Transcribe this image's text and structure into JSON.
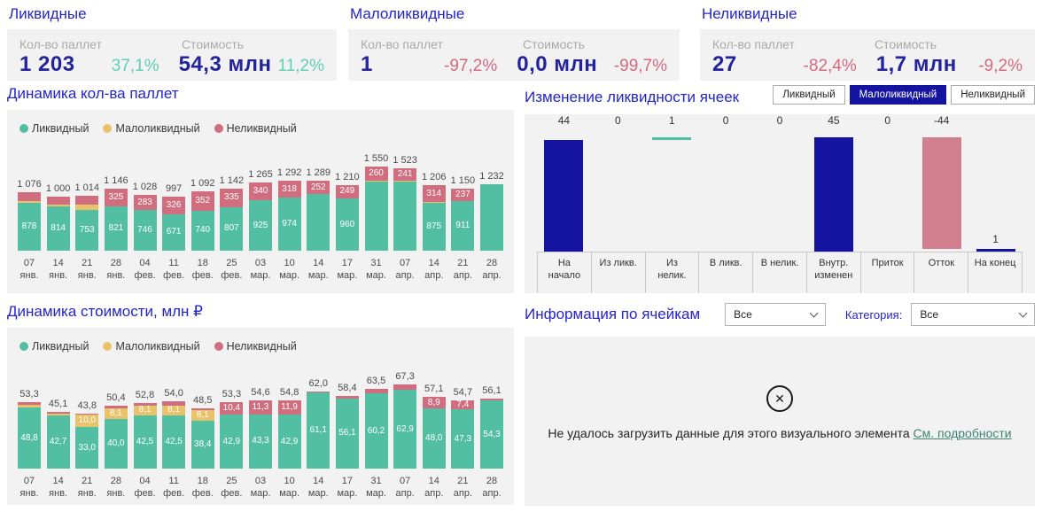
{
  "colors": {
    "title_blue": "#2424CB",
    "kpi_value_navy": "#23239B",
    "positive": "#5ED1B0",
    "negative": "#D5697F",
    "liquid_teal": "#53BFA2",
    "lowliquid_yellow": "#E9C36A",
    "illiquid_pink": "#D06E7F",
    "waterfall_navy": "#1414A0",
    "panel_bg": "#F2F2F2"
  },
  "kpi": {
    "cards": [
      {
        "title": "Ликвидные",
        "label1": "Кол-во паллет",
        "value1": "1 203",
        "pct1": "37,1%",
        "pct1_sign": "pos",
        "label2": "Стоимость",
        "value2": "54,3 млн",
        "pct2": "11,2%",
        "pct2_sign": "pos"
      },
      {
        "title": "Малоликвидные",
        "label1": "Кол-во паллет",
        "value1": "1",
        "pct1": "-97,2%",
        "pct1_sign": "neg",
        "label2": "Стоимость",
        "value2": "0,0 млн",
        "pct2": "-99,7%",
        "pct2_sign": "neg"
      },
      {
        "title": "Неликвидные",
        "label1": "Кол-во паллет",
        "value1": "27",
        "pct1": "-82,4%",
        "pct1_sign": "neg",
        "label2": "Стоимость",
        "value2": "1,7 млн",
        "pct2": "-9,2%",
        "pct2_sign": "neg"
      }
    ]
  },
  "chart_data": [
    {
      "id": "pallets",
      "type": "bar",
      "stacked": true,
      "title": "Динамика кол-ва паллет",
      "legend": [
        "Ликвидный",
        "Малоликвидный",
        "Неликвидный"
      ],
      "ylim": [
        0,
        1550
      ],
      "bars": [
        {
          "d": "07",
          "m": "янв.",
          "total": "1 076",
          "liq": 878,
          "mal": 38,
          "nel": 160,
          "liq_label": "878",
          "mal_label": "",
          "nel_label": ""
        },
        {
          "d": "14",
          "m": "янв.",
          "total": "1 000",
          "liq": 814,
          "mal": 30,
          "nel": 156,
          "liq_label": "814",
          "mal_label": "",
          "nel_label": ""
        },
        {
          "d": "21",
          "m": "янв.",
          "total": "1 014",
          "liq": 753,
          "mal": 90,
          "nel": 171,
          "liq_label": "753",
          "mal_label": "",
          "nel_label": ""
        },
        {
          "d": "28",
          "m": "янв.",
          "total": "1 146",
          "liq": 821,
          "mal": 0,
          "nel": 325,
          "liq_label": "821",
          "mal_label": "",
          "nel_label": "325"
        },
        {
          "d": "04",
          "m": "фев.",
          "total": "1 028",
          "liq": 746,
          "mal": 0,
          "nel": 283,
          "liq_label": "746",
          "mal_label": "",
          "nel_label": "283"
        },
        {
          "d": "11",
          "m": "фев.",
          "total": "997",
          "liq": 671,
          "mal": 0,
          "nel": 326,
          "liq_label": "671",
          "mal_label": "",
          "nel_label": "326"
        },
        {
          "d": "18",
          "m": "фев.",
          "total": "1 092",
          "liq": 740,
          "mal": 0,
          "nel": 352,
          "liq_label": "740",
          "mal_label": "",
          "nel_label": "352"
        },
        {
          "d": "25",
          "m": "фев.",
          "total": "1 142",
          "liq": 807,
          "mal": 0,
          "nel": 335,
          "liq_label": "807",
          "mal_label": "",
          "nel_label": "335"
        },
        {
          "d": "03",
          "m": "мар.",
          "total": "1 265",
          "liq": 925,
          "mal": 0,
          "nel": 340,
          "liq_label": "925",
          "mal_label": "",
          "nel_label": "340"
        },
        {
          "d": "10",
          "m": "мар.",
          "total": "1 292",
          "liq": 974,
          "mal": 0,
          "nel": 318,
          "liq_label": "974",
          "mal_label": "",
          "nel_label": "318"
        },
        {
          "d": "14",
          "m": "мар.",
          "total": "1 289",
          "liq": 1037,
          "mal": 0,
          "nel": 252,
          "liq_label": "",
          "mal_label": "",
          "nel_label": "252"
        },
        {
          "d": "17",
          "m": "мар.",
          "total": "1 210",
          "liq": 960,
          "mal": 1,
          "nel": 249,
          "liq_label": "960",
          "mal_label": "",
          "nel_label": "249"
        },
        {
          "d": "31",
          "m": "мар.",
          "total": "1 550",
          "liq": 1280,
          "mal": 10,
          "nel": 260,
          "liq_label": "",
          "mal_label": "",
          "nel_label": "260"
        },
        {
          "d": "07",
          "m": "апр.",
          "total": "1 523",
          "liq": 1272,
          "mal": 10,
          "nel": 241,
          "liq_label": "",
          "mal_label": "",
          "nel_label": "241"
        },
        {
          "d": "14",
          "m": "апр.",
          "total": "1 206",
          "liq": 875,
          "mal": 17,
          "nel": 314,
          "liq_label": "875",
          "mal_label": "",
          "nel_label": "314"
        },
        {
          "d": "21",
          "m": "апр.",
          "total": "1 150",
          "liq": 911,
          "mal": 2,
          "nel": 237,
          "liq_label": "911",
          "mal_label": "",
          "nel_label": "237"
        },
        {
          "d": "28",
          "m": "апр.",
          "total": "1 232",
          "liq": 1222,
          "mal": 0,
          "nel": 10,
          "liq_label": "",
          "mal_label": "",
          "nel_label": ""
        }
      ]
    },
    {
      "id": "liquidity_change",
      "type": "waterfall",
      "title": "Изменение ликвидности ячеек",
      "buttons": [
        "Ликвидный",
        "Малоликвидный",
        "Неликвидный"
      ],
      "selected_button": "Малоликвидный",
      "ylim": [
        0,
        45
      ],
      "steps": [
        {
          "label": "На\nначало",
          "value": "44",
          "from": 0,
          "to": 44,
          "color": "navy",
          "label_above_bar": false
        },
        {
          "label": "Из ликв.",
          "value": "0",
          "from": 44,
          "to": 44,
          "color": "none",
          "label_above_bar": false
        },
        {
          "label": "Из\nнелик.",
          "value": "1",
          "from": 44,
          "to": 45,
          "color": "teal",
          "label_above_bar": false
        },
        {
          "label": "В ликв.",
          "value": "0",
          "from": 45,
          "to": 45,
          "color": "none",
          "label_above_bar": false
        },
        {
          "label": "В нелик.",
          "value": "0",
          "from": 45,
          "to": 45,
          "color": "none",
          "label_above_bar": false
        },
        {
          "label": "Внутр.\nизменен",
          "value": "45",
          "from": 0,
          "to": 45,
          "color": "navy",
          "label_above_bar": false
        },
        {
          "label": "Приток",
          "value": "0",
          "from": 45,
          "to": 45,
          "color": "none",
          "label_above_bar": false
        },
        {
          "label": "Отток",
          "value": "-44",
          "from": 1,
          "to": 45,
          "color": "pink",
          "label_above_bar": false
        },
        {
          "label": "На конец",
          "value": "1",
          "from": 0,
          "to": 1,
          "color": "navy",
          "label_above_bar": true
        }
      ]
    },
    {
      "id": "cost",
      "type": "bar",
      "stacked": true,
      "title": "Динамика стоимости, млн ₽",
      "legend": [
        "Ликвидный",
        "Малоликвидный",
        "Неликвидный"
      ],
      "ylim": [
        0,
        67.3
      ],
      "bars": [
        {
          "d": "07",
          "m": "янв.",
          "total": "53,3",
          "liq": 48.8,
          "mal": 2.2,
          "nel": 2.3,
          "liq_label": "48,8",
          "mal_label": "",
          "nel_label": ""
        },
        {
          "d": "14",
          "m": "янв.",
          "total": "45,1",
          "liq": 42.7,
          "mal": 1.2,
          "nel": 1.2,
          "liq_label": "42,7",
          "mal_label": "",
          "nel_label": ""
        },
        {
          "d": "21",
          "m": "янв.",
          "total": "43,8",
          "liq": 33.0,
          "mal": 10.0,
          "nel": 0.8,
          "liq_label": "33,0",
          "mal_label": "10,0",
          "nel_label": ""
        },
        {
          "d": "28",
          "m": "янв.",
          "total": "50,4",
          "liq": 40.0,
          "mal": 8.1,
          "nel": 2.3,
          "liq_label": "40,0",
          "mal_label": "8,1",
          "nel_label": ""
        },
        {
          "d": "04",
          "m": "фев.",
          "total": "52,8",
          "liq": 42.5,
          "mal": 8.1,
          "nel": 2.2,
          "liq_label": "42,5",
          "mal_label": "8,1",
          "nel_label": ""
        },
        {
          "d": "11",
          "m": "фев.",
          "total": "54,0",
          "liq": 42.5,
          "mal": 8.1,
          "nel": 3.4,
          "liq_label": "42,5",
          "mal_label": "8,1",
          "nel_label": ""
        },
        {
          "d": "18",
          "m": "фев.",
          "total": "48,5",
          "liq": 38.4,
          "mal": 8.1,
          "nel": 2.0,
          "liq_label": "38,4",
          "mal_label": "8,1",
          "nel_label": ""
        },
        {
          "d": "25",
          "m": "фев.",
          "total": "53,3",
          "liq": 42.9,
          "mal": 0,
          "nel": 10.4,
          "liq_label": "42,9",
          "mal_label": "",
          "nel_label": "10,4"
        },
        {
          "d": "03",
          "m": "мар.",
          "total": "54,6",
          "liq": 43.3,
          "mal": 0,
          "nel": 11.3,
          "liq_label": "43,3",
          "mal_label": "",
          "nel_label": "11,3"
        },
        {
          "d": "10",
          "m": "мар.",
          "total": "54,8",
          "liq": 42.9,
          "mal": 0,
          "nel": 11.9,
          "liq_label": "42,9",
          "mal_label": "",
          "nel_label": "11,9"
        },
        {
          "d": "14",
          "m": "мар.",
          "total": "62,0",
          "liq": 61.1,
          "mal": 0,
          "nel": 0.9,
          "liq_label": "61,1",
          "mal_label": "",
          "nel_label": ""
        },
        {
          "d": "17",
          "m": "мар.",
          "total": "58,4",
          "liq": 56.1,
          "mal": 0,
          "nel": 2.3,
          "liq_label": "56,1",
          "mal_label": "",
          "nel_label": ""
        },
        {
          "d": "31",
          "m": "мар.",
          "total": "63,5",
          "liq": 60.2,
          "mal": 0,
          "nel": 3.3,
          "liq_label": "60,2",
          "mal_label": "",
          "nel_label": ""
        },
        {
          "d": "07",
          "m": "апр.",
          "total": "67,3",
          "liq": 62.9,
          "mal": 0,
          "nel": 4.4,
          "liq_label": "62,9",
          "mal_label": "",
          "nel_label": ""
        },
        {
          "d": "14",
          "m": "апр.",
          "total": "57,1",
          "liq": 48.0,
          "mal": 0.2,
          "nel": 8.9,
          "liq_label": "48,0",
          "mal_label": "",
          "nel_label": "8,9"
        },
        {
          "d": "21",
          "m": "апр.",
          "total": "54,7",
          "liq": 47.3,
          "mal": 0,
          "nel": 7.4,
          "liq_label": "47,3",
          "mal_label": "",
          "nel_label": "7,4"
        },
        {
          "d": "28",
          "m": "апр.",
          "total": "56,1",
          "liq": 54.3,
          "mal": 0,
          "nel": 1.8,
          "liq_label": "54,3",
          "mal_label": "",
          "nel_label": ""
        }
      ]
    }
  ],
  "info_panel": {
    "title": "Информация по ячейкам",
    "filter_value": "Все",
    "category_label": "Категория:",
    "category_value": "Все",
    "error_text": "Не удалось загрузить данные для этого визуального элемента",
    "error_link": "См. подробности",
    "error_icon_glyph": "✕"
  }
}
